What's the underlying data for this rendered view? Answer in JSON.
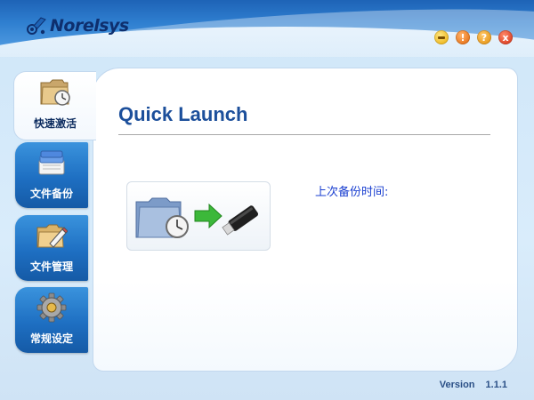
{
  "app": {
    "brand": "Norelsys"
  },
  "window_controls": {
    "minimize": "",
    "warning": "!",
    "help": "?",
    "close": "x"
  },
  "sidebar": {
    "items": [
      {
        "label": "快速激活",
        "icon": "clock-folder-icon",
        "active": true
      },
      {
        "label": "文件备份",
        "icon": "document-stack-icon",
        "active": false
      },
      {
        "label": "文件管理",
        "icon": "folder-edit-icon",
        "active": false
      },
      {
        "label": "常规设定",
        "icon": "gear-icon",
        "active": false
      }
    ]
  },
  "main": {
    "title": "Quick Launch",
    "last_backup_label": "上次备份时间:"
  },
  "footer": {
    "version_label": "Version",
    "version_number": "1.1.1"
  },
  "colors": {
    "header_blue": "#1e63b6",
    "title_blue": "#1c4f9b",
    "link_blue": "#1a3fd0",
    "nav_blue": "#1e6fc2",
    "arrow_green": "#3cb83a"
  }
}
